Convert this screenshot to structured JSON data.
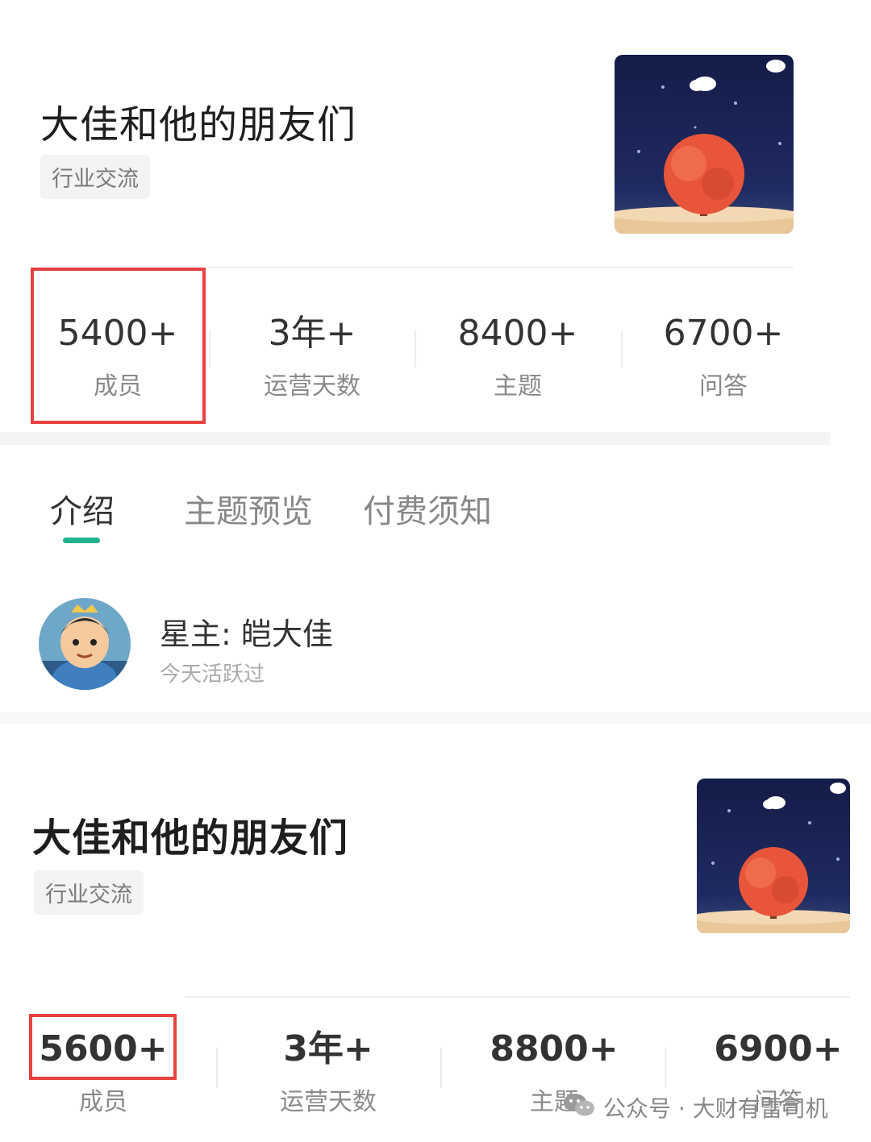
{
  "card1": {
    "title": "大佳和他的朋友们",
    "tag": "行业交流",
    "stats": [
      {
        "num": "5400+",
        "label": "成员"
      },
      {
        "num": "3年+",
        "label": "运营天数"
      },
      {
        "num": "8400+",
        "label": "主题"
      },
      {
        "num": "6700+",
        "label": "问答"
      }
    ],
    "tabs": [
      "介绍",
      "主题预览",
      "付费须知"
    ],
    "owner": {
      "name": "星主: 皑大佳",
      "status": "今天活跃过"
    }
  },
  "card2": {
    "title": "大佳和他的朋友们",
    "tag": "行业交流",
    "stats": [
      {
        "num": "5600+",
        "label": "成员"
      },
      {
        "num": "3年+",
        "label": "运营天数"
      },
      {
        "num": "8800+",
        "label": "主题"
      },
      {
        "num": "6900+",
        "label": "问答"
      }
    ]
  },
  "watermark": {
    "text": "公众号 · 大财有雷司机",
    "icon": "wechat-icon"
  },
  "colors": {
    "highlight": "#e8413f",
    "tab_indicator": "#1fb28f",
    "cover_sky": "#1b2455",
    "tree": "#e8553a"
  }
}
